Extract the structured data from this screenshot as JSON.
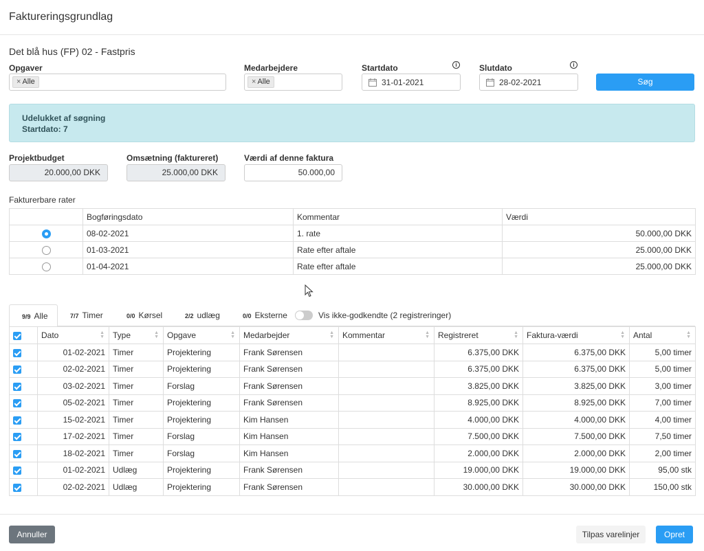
{
  "header": {
    "title": "Faktureringsgrundlag"
  },
  "project": {
    "name": "Det blå hus (FP) 02 - Fastpris"
  },
  "filters": {
    "opgaver_label": "Opgaver",
    "opgaver_tag": "Alle",
    "medarbejdere_label": "Medarbejdere",
    "medarbejdere_tag": "Alle",
    "startdato_label": "Startdato",
    "startdato_value": "31-01-2021",
    "slutdato_label": "Slutdato",
    "slutdato_value": "28-02-2021",
    "search_button": "Søg",
    "tag_remove": "×",
    "info_glyph": "i"
  },
  "alert": {
    "title": "Udelukket af søgning",
    "detail": "Startdato: 7"
  },
  "summary": {
    "budget_label": "Projektbudget",
    "budget_value": "20.000,00 DKK",
    "revenue_label": "Omsætning (faktureret)",
    "revenue_value": "25.000,00 DKK",
    "invoice_label": "Værdi af denne faktura",
    "invoice_value": "50.000,00"
  },
  "rates": {
    "section_label": "Fakturerbare rater",
    "columns": [
      "",
      "Bogføringsdato",
      "Kommentar",
      "Værdi"
    ],
    "rows": [
      {
        "selected": true,
        "date": "08-02-2021",
        "comment": "1. rate",
        "value": "50.000,00 DKK"
      },
      {
        "selected": false,
        "date": "01-03-2021",
        "comment": "Rate efter aftale",
        "value": "25.000,00 DKK"
      },
      {
        "selected": false,
        "date": "01-04-2021",
        "comment": "Rate efter aftale",
        "value": "25.000,00 DKK"
      }
    ]
  },
  "tabs": [
    {
      "count": "9/9",
      "label": "Alle"
    },
    {
      "count": "7/7",
      "label": "Timer"
    },
    {
      "count": "0/0",
      "label": "Kørsel"
    },
    {
      "count": "2/2",
      "label": "udlæg"
    },
    {
      "count": "0/0",
      "label": "Eksterne"
    }
  ],
  "toggle": {
    "label": "Vis ikke-godkendte (2 registreringer)",
    "on": false
  },
  "entries": {
    "columns": [
      "Dato",
      "Type",
      "Opgave",
      "Medarbejder",
      "Kommentar",
      "Registreret",
      "Faktura-værdi",
      "Antal"
    ],
    "rows": [
      {
        "date": "01-02-2021",
        "type": "Timer",
        "task": "Projektering",
        "employee": "Frank Sørensen",
        "comment": "",
        "registered": "6.375,00 DKK",
        "invoice": "6.375,00 DKK",
        "qty": "5,00 timer"
      },
      {
        "date": "02-02-2021",
        "type": "Timer",
        "task": "Projektering",
        "employee": "Frank Sørensen",
        "comment": "",
        "registered": "6.375,00 DKK",
        "invoice": "6.375,00 DKK",
        "qty": "5,00 timer"
      },
      {
        "date": "03-02-2021",
        "type": "Timer",
        "task": "Forslag",
        "employee": "Frank Sørensen",
        "comment": "",
        "registered": "3.825,00 DKK",
        "invoice": "3.825,00 DKK",
        "qty": "3,00 timer"
      },
      {
        "date": "05-02-2021",
        "type": "Timer",
        "task": "Projektering",
        "employee": "Frank Sørensen",
        "comment": "",
        "registered": "8.925,00 DKK",
        "invoice": "8.925,00 DKK",
        "qty": "7,00 timer"
      },
      {
        "date": "15-02-2021",
        "type": "Timer",
        "task": "Projektering",
        "employee": "Kim Hansen",
        "comment": "",
        "registered": "4.000,00 DKK",
        "invoice": "4.000,00 DKK",
        "qty": "4,00 timer"
      },
      {
        "date": "17-02-2021",
        "type": "Timer",
        "task": "Forslag",
        "employee": "Kim Hansen",
        "comment": "",
        "registered": "7.500,00 DKK",
        "invoice": "7.500,00 DKK",
        "qty": "7,50 timer"
      },
      {
        "date": "18-02-2021",
        "type": "Timer",
        "task": "Forslag",
        "employee": "Kim Hansen",
        "comment": "",
        "registered": "2.000,00 DKK",
        "invoice": "2.000,00 DKK",
        "qty": "2,00 timer"
      },
      {
        "date": "01-02-2021",
        "type": "Udlæg",
        "task": "Projektering",
        "employee": "Frank Sørensen",
        "comment": "",
        "registered": "19.000,00 DKK",
        "invoice": "19.000,00 DKK",
        "qty": "95,00 stk"
      },
      {
        "date": "02-02-2021",
        "type": "Udlæg",
        "task": "Projektering",
        "employee": "Frank Sørensen",
        "comment": "",
        "registered": "30.000,00 DKK",
        "invoice": "30.000,00 DKK",
        "qty": "150,00 stk"
      }
    ]
  },
  "footer": {
    "cancel": "Annuller",
    "adjust": "Tilpas varelinjer",
    "create": "Opret"
  },
  "colors": {
    "primary": "#2a9df4",
    "alert_bg": "#c7e9ee",
    "dark_button": "#6c757d"
  }
}
